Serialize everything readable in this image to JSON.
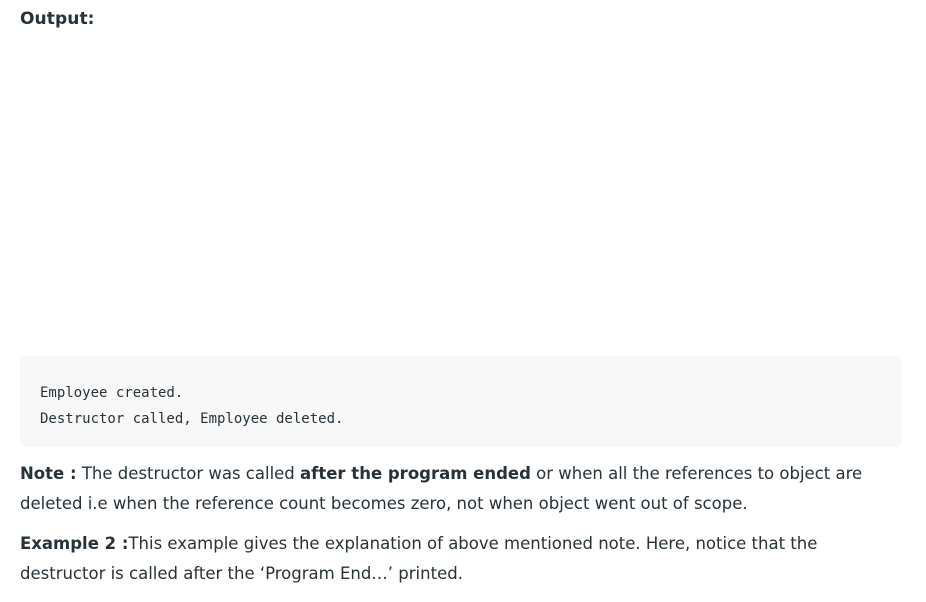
{
  "output_heading": "Output:",
  "code_output": {
    "lines": [
      "Employee created.",
      "Destructor called, Employee deleted."
    ]
  },
  "note": {
    "label": "Note :",
    "text_before": " The destructor was called ",
    "emphasis": "after the program ended",
    "text_after": " or when all the references to object are deleted i.e when the reference count becomes zero, not when object went out of scope."
  },
  "example": {
    "label": "Example 2 :",
    "text": "This example gives the explanation of above mentioned note. Here, notice that the destructor is called after the ‘Program End…’ printed."
  }
}
